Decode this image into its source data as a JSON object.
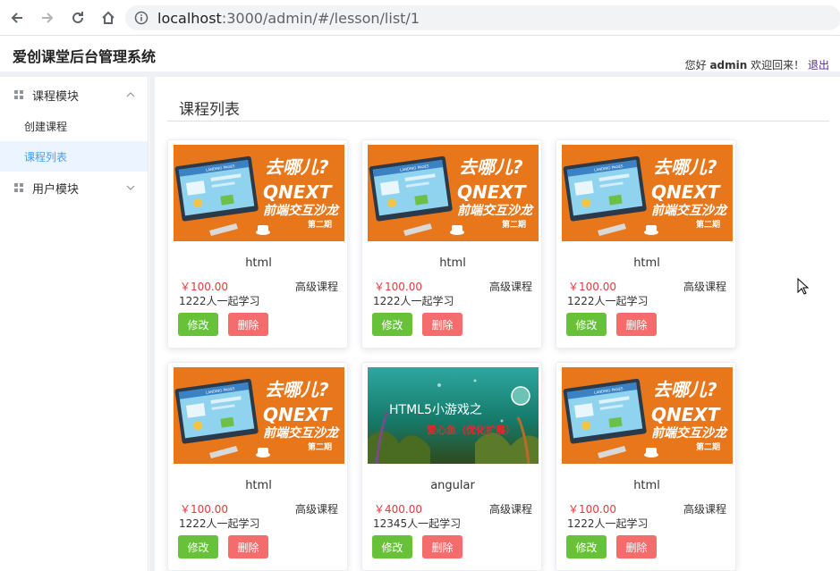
{
  "browser": {
    "url_host": "localhost",
    "url_path": ":3000/admin/#/lesson/list/1"
  },
  "header": {
    "title": "爱创课堂后台管理系统",
    "greeting": "您好",
    "username": "admin",
    "welcome": "欢迎回来！",
    "logout": "退出"
  },
  "sidebar": {
    "groups": [
      {
        "label": "课程模块",
        "items": [
          {
            "label": "创建课程"
          },
          {
            "label": "课程列表"
          }
        ]
      },
      {
        "label": "用户模块"
      }
    ]
  },
  "main": {
    "heading": "课程列表",
    "cards": [
      {
        "name": "html",
        "price": "￥100.00",
        "level": "高级课程",
        "learners": "1222人一起学习",
        "edit": "修改",
        "delete": "删除",
        "banner": {
          "line1": "去哪儿?",
          "line2": "QNEXT",
          "line3": "前端交互沙龙",
          "line4": "第二期",
          "screen": "LANDING PAGES"
        }
      },
      {
        "name": "html",
        "price": "￥100.00",
        "level": "高级课程",
        "learners": "1222人一起学习",
        "edit": "修改",
        "delete": "删除",
        "banner": {
          "line1": "去哪儿?",
          "line2": "QNEXT",
          "line3": "前端交互沙龙",
          "line4": "第二期",
          "screen": "LANDING PAGES"
        }
      },
      {
        "name": "html",
        "price": "￥100.00",
        "level": "高级课程",
        "learners": "1222人一起学习",
        "edit": "修改",
        "delete": "删除",
        "banner": {
          "line1": "去哪儿?",
          "line2": "QNEXT",
          "line3": "前端交互沙龙",
          "line4": "第二期",
          "screen": "LANDING PAGES"
        }
      },
      {
        "name": "html",
        "price": "￥100.00",
        "level": "高级课程",
        "learners": "1222人一起学习",
        "edit": "修改",
        "delete": "删除",
        "banner": {
          "line1": "去哪儿?",
          "line2": "QNEXT",
          "line3": "前端交互沙龙",
          "line4": "第二期",
          "screen": "LANDING PAGES"
        }
      },
      {
        "name": "angular",
        "price": "￥400.00",
        "level": "高级课程",
        "learners": "12345人一起学习",
        "edit": "修改",
        "delete": "删除",
        "banner": {
          "line1": "HTML5小游戏之",
          "line2": "爱心鱼（优化扩展）"
        }
      },
      {
        "name": "html",
        "price": "￥100.00",
        "level": "高级课程",
        "learners": "1222人一起学习",
        "edit": "修改",
        "delete": "删除",
        "banner": {
          "line1": "去哪儿?",
          "line2": "QNEXT",
          "line3": "前端交互沙龙",
          "line4": "第二期",
          "screen": "LANDING PAGES"
        }
      }
    ]
  },
  "colors": {
    "accent": "#409eff",
    "price": "#e4393c",
    "edit_button": "#67c23a",
    "delete_button": "#f56c6c",
    "banner_orange": "#e8761a"
  }
}
